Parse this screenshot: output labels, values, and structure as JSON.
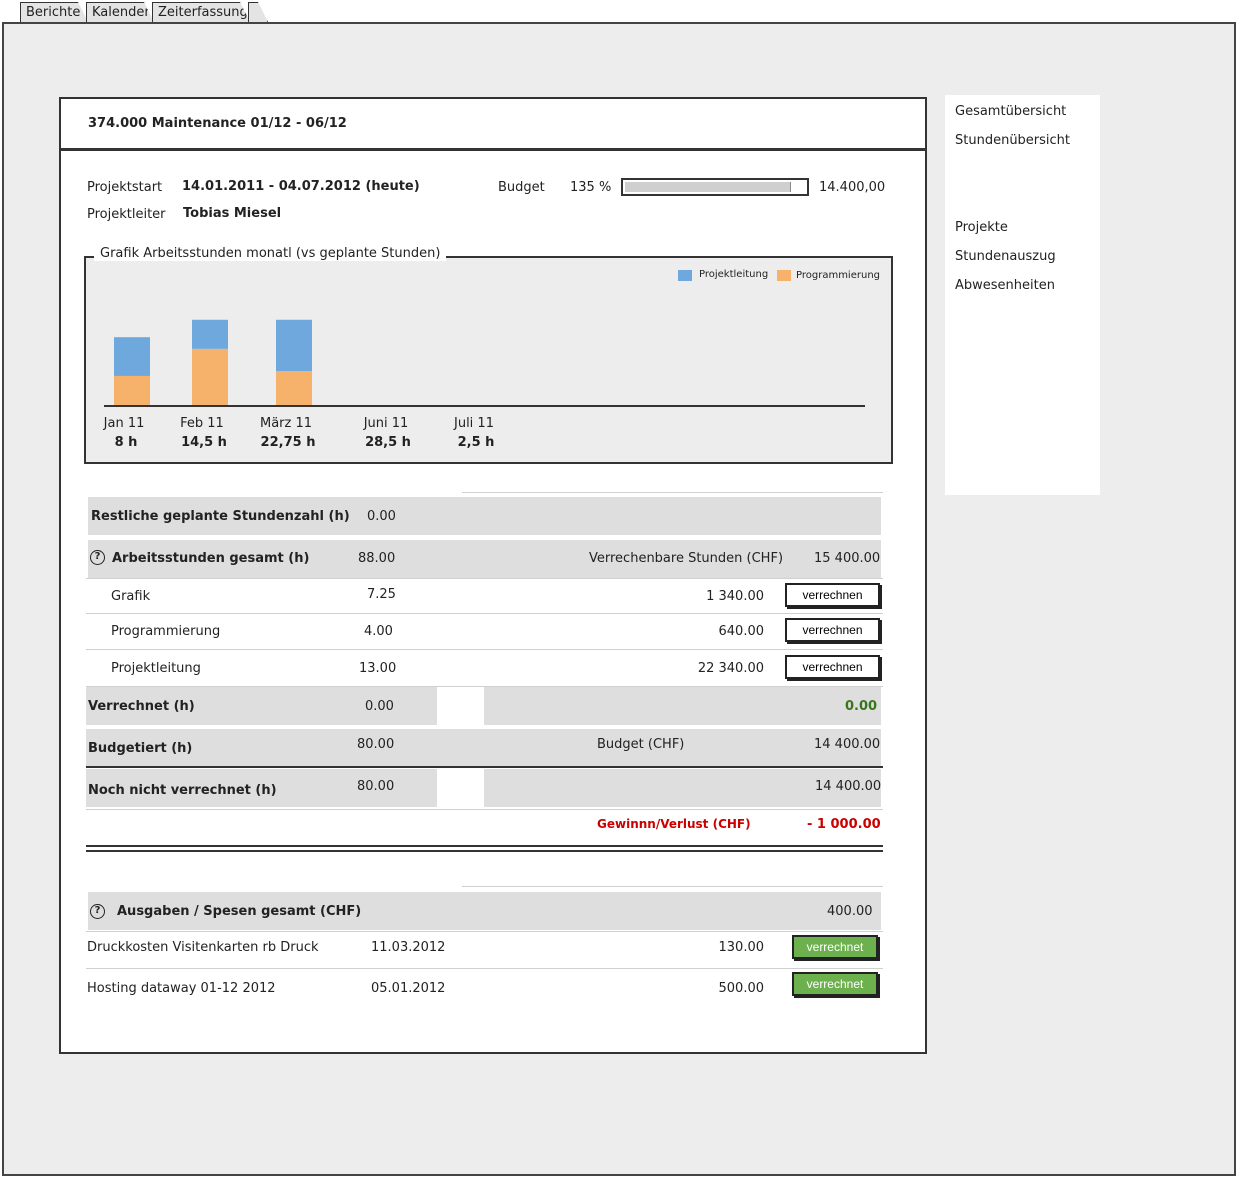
{
  "tabs": [
    "Berichte",
    "Kalender",
    "Zeiterfassung",
    ""
  ],
  "project": {
    "title": "374.000 Maintenance 01/12 - 06/12",
    "start_label": "Projektstart",
    "start_value": "14.01.2011 - 04.07.2012 (heute)",
    "leader_label": "Projektleiter",
    "leader_value": "Tobias Miesel",
    "budget_label": "Budget",
    "budget_percent": "135 %",
    "budget_fill_fraction": 0.92,
    "budget_amount": "14.400,00"
  },
  "chart_data": {
    "type": "bar",
    "title": "Grafik Arbeitsstunden monatl (vs geplante Stunden)",
    "categories": [
      "Jan 11",
      "Feb 11",
      "März 11",
      "Juni 11",
      "Juli 11"
    ],
    "totals": [
      "8 h",
      "14,5 h",
      "22,75 h",
      "28,5 h",
      "2,5 h"
    ],
    "series": [
      {
        "name": "Projektleitung",
        "color": "#6fa8dc",
        "values": [
          4,
          3,
          5.3,
          0,
          0
        ]
      },
      {
        "name": "Programmierung",
        "color": "#f6b26b",
        "values": [
          3,
          5.8,
          3.5,
          0,
          0
        ]
      }
    ],
    "ylim": [
      0,
      9.5
    ],
    "stacked": true
  },
  "hours": {
    "remaining_label": "Restliche geplante Stundenzahl (h)",
    "remaining_value": "0.00",
    "total_label": "Arbeitsstunden gesamt (h)",
    "total_value": "88.00",
    "billable_label": "Verrechenbare Stunden (CHF)",
    "billable_value": "15 400.00",
    "rows": [
      {
        "label": "Grafik",
        "hours": "7.25",
        "amount": "1 340.00",
        "button": "verrechnen"
      },
      {
        "label": "Programmierung",
        "hours": "4.00",
        "amount": "640.00",
        "button": "verrechnen"
      },
      {
        "label": "Projektleitung",
        "hours": "13.00",
        "amount": "22 340.00",
        "button": "verrechnen"
      }
    ],
    "billed_label": "Verrechnet (h)",
    "billed_hours": "0.00",
    "billed_amount": "0.00",
    "budgeted_label": "Budgetiert (h)",
    "budgeted_hours": "80.00",
    "budget_chf_label": "Budget (CHF)",
    "budget_chf_value": "14 400.00",
    "unbilled_label": "Noch nicht verrechnet (h)",
    "unbilled_hours": "80.00",
    "unbilled_amount": "14 400.00",
    "profit_label": "Gewinnn/Verlust (CHF)",
    "profit_value": "-  1 000.00"
  },
  "expenses": {
    "total_label": "Ausgaben / Spesen gesamt (CHF)",
    "total_value": "400.00",
    "rows": [
      {
        "label": "Druckkosten Visitenkarten rb Druck",
        "date": "11.03.2012",
        "amount": "130.00",
        "button": "verrechnet"
      },
      {
        "label": "Hosting dataway 01-12 2012",
        "date": "05.01.2012",
        "amount": "500.00",
        "button": "verrechnet"
      }
    ]
  },
  "sidebar": {
    "items": [
      "Gesamtübersicht",
      "Stundenübersicht",
      "Projekte",
      "Stundenauszug",
      "Abwesenheiten"
    ]
  },
  "colors": {
    "positive": "#38761d",
    "negative": "#cc0000",
    "button_green": "#6db14e"
  }
}
